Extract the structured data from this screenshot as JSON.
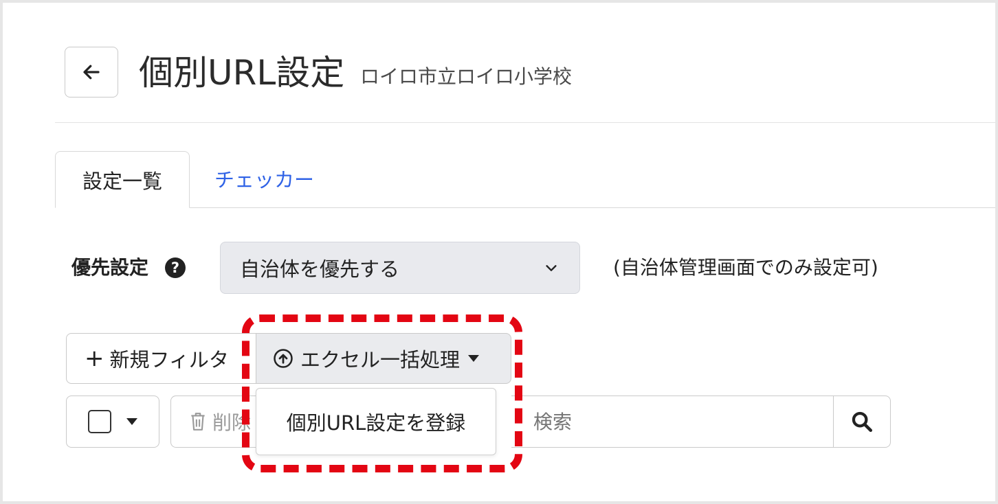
{
  "header": {
    "title": "個別URL設定",
    "subtitle": "ロイロ市立ロイロ小学校",
    "back_icon": "arrow-left-icon"
  },
  "tabs": [
    {
      "label": "設定一覧",
      "active": true
    },
    {
      "label": "チェッカー",
      "active": false
    }
  ],
  "priority": {
    "label": "優先設定",
    "help_icon": "question-circle-icon",
    "help_glyph": "?",
    "selected": "自治体を優先する",
    "note": "(自治体管理画面でのみ設定可)"
  },
  "toolbar": {
    "new_filter_label": "新規フィルタ",
    "excel_label": "エクセル一括処理",
    "excel_icon": "upload-circle-icon",
    "delete_label": "削除",
    "search_placeholder": "検索",
    "search_icon": "search-icon"
  },
  "dropdown": {
    "items": [
      {
        "label": "個別URL設定を登録"
      }
    ]
  },
  "colors": {
    "link": "#2f62e6",
    "highlight": "#e30613",
    "select_bg": "#e9eaee"
  }
}
